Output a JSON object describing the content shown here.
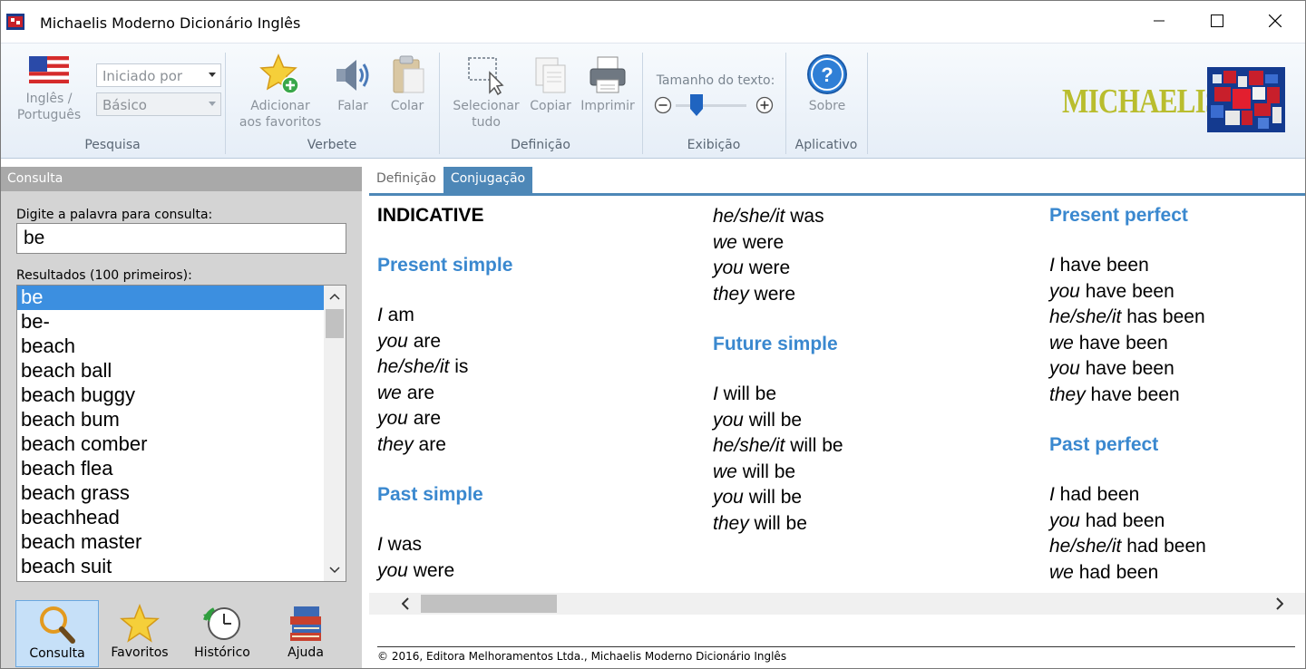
{
  "window": {
    "title": "Michaelis Moderno Dicionário Inglês"
  },
  "ribbon": {
    "pesquisa": {
      "group_label": "Pesquisa",
      "language_button": "Inglês /\nPortuguês",
      "combo_mode": "Iniciado por",
      "combo_level": "Básico"
    },
    "verbete": {
      "group_label": "Verbete",
      "add_favorites": "Adicionar\naos favoritos",
      "speak": "Falar",
      "paste": "Colar"
    },
    "definicao": {
      "group_label": "Definição",
      "select_all": "Selecionar\ntudo",
      "copy": "Copiar",
      "print": "Imprimir"
    },
    "exibicao": {
      "group_label": "Exibição",
      "text_size_label": "Tamanho do texto:",
      "text_size_level": 0.25
    },
    "aplicativo": {
      "group_label": "Aplicativo",
      "about": "Sobre"
    },
    "brand": "MICHAELIS"
  },
  "left": {
    "panel_title": "Consulta",
    "input_label": "Digite a palavra para consulta:",
    "input_value": "be",
    "results_label": "Resultados (100 primeiros):",
    "results": [
      "be",
      "be-",
      "beach",
      "beach ball",
      "beach buggy",
      "beach bum",
      "beach comber",
      "beach flea",
      "beach grass",
      "beachhead",
      "beach master",
      "beach suit"
    ],
    "selected_index": 0,
    "nav": [
      "Consulta",
      "Favoritos",
      "Histórico",
      "Ajuda"
    ]
  },
  "tabs": [
    "Definição",
    "Conjugação"
  ],
  "active_tab": 1,
  "conjugation": {
    "heading": "INDICATIVE",
    "present_simple": {
      "title": "Present simple",
      "rows": [
        [
          "I",
          " am"
        ],
        [
          "you",
          " are"
        ],
        [
          "he/she/it",
          " is"
        ],
        [
          "we",
          " are"
        ],
        [
          "you",
          " are"
        ],
        [
          "they",
          " are"
        ]
      ]
    },
    "past_simple": {
      "title": "Past simple",
      "rows": [
        [
          "I",
          " was"
        ],
        [
          "you",
          " were"
        ],
        [
          "he/she/it",
          " was"
        ],
        [
          "we",
          " were"
        ],
        [
          "you",
          " were"
        ],
        [
          "they",
          " were"
        ]
      ]
    },
    "future_simple": {
      "title": "Future simple",
      "rows": [
        [
          "I",
          " will be"
        ],
        [
          "you",
          " will be"
        ],
        [
          "he/she/it",
          " will be"
        ],
        [
          "we",
          " will be"
        ],
        [
          "you",
          " will be"
        ],
        [
          "they",
          " will be"
        ]
      ]
    },
    "present_perfect": {
      "title": "Present perfect",
      "rows": [
        [
          "I",
          " have been"
        ],
        [
          "you",
          " have been"
        ],
        [
          "he/she/it",
          " has been"
        ],
        [
          "we",
          " have been"
        ],
        [
          "you",
          " have been"
        ],
        [
          "they",
          " have been"
        ]
      ]
    },
    "past_perfect": {
      "title": "Past perfect",
      "rows": [
        [
          "I",
          " had been"
        ],
        [
          "you",
          " had been"
        ],
        [
          "he/she/it",
          " had been"
        ],
        [
          "we",
          " had been"
        ]
      ]
    }
  },
  "footer": "© 2016, Editora Melhoramentos Ltda., Michaelis Moderno Dicionário Inglês",
  "colors": {
    "accent": "#3a88cf",
    "tab_active": "#4d87b7",
    "selection": "#3c8fe0"
  }
}
